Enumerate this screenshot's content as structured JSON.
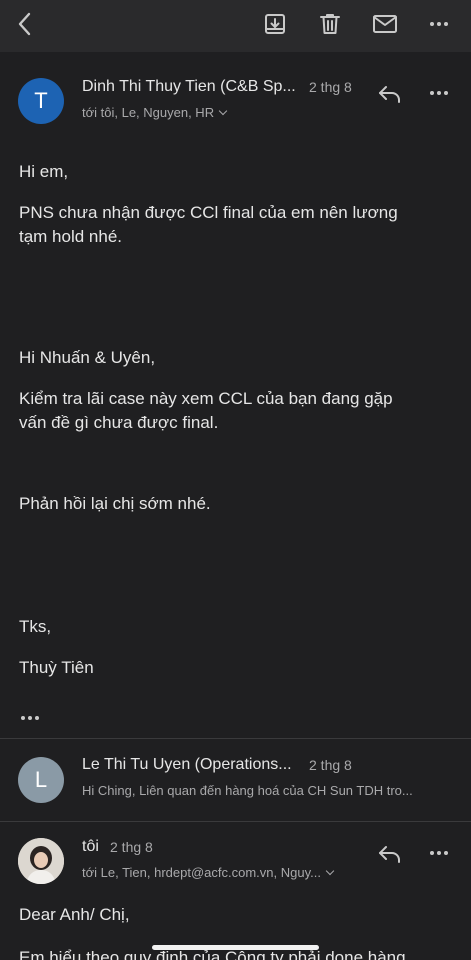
{
  "toolbar": {
    "back_icon": "chevron-left-icon",
    "archive_icon": "archive-icon",
    "delete_icon": "trash-icon",
    "mark_unread_icon": "envelope-icon",
    "more_icon": "more-horizontal-icon"
  },
  "messages": [
    {
      "avatar_letter": "T",
      "avatar_color": "#1d63b3",
      "sender": "Dinh Thi Thuy Tien (C&B Sp...",
      "date": "2 thg 8",
      "recipients": "tới tôi, Le, Nguyen, HR",
      "body": [
        "Hi em,",
        "PNS chưa nhận được CCl final của em nên lương",
        "tạm hold nhé.",
        "Hi Nhuấn & Uyên,",
        "Kiểm tra lãi case này xem CCL của bạn đang gặp",
        "vấn đề gì chưa được final.",
        "Phản hồi lại chị sớm nhé.",
        "Tks,",
        "Thuỳ Tiên"
      ]
    },
    {
      "avatar_letter": "L",
      "avatar_color": "#8a9aa6",
      "sender": "Le Thi Tu Uyen (Operations...",
      "date": "2 thg 8",
      "snippet": "Hi Ching, Liên quan đến hàng hoá của CH Sun TDH tro..."
    },
    {
      "sender": "tôi",
      "date": "2 thg 8",
      "recipients": "tới Le, Tien, hrdept@acfc.com.vn, Nguy...",
      "body": [
        "Dear Anh/ Chị,",
        "Em hiểu theo quy định của Công ty phải done hàng"
      ]
    }
  ]
}
